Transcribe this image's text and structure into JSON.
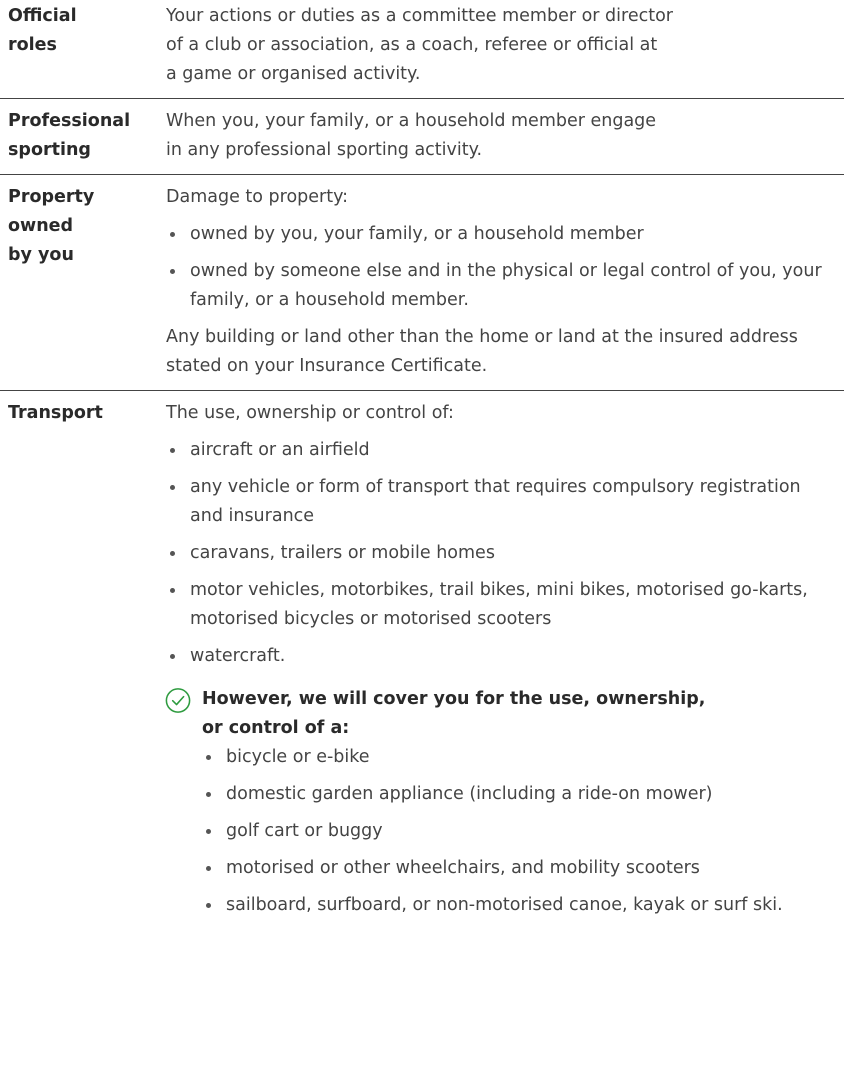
{
  "rows": [
    {
      "term": "Official roles",
      "desc": [
        "Your actions or duties as a committee member or director",
        "of a club or association, as a coach, referee or official at",
        "a game or organised activity."
      ]
    },
    {
      "term": "Professional sporting",
      "desc": [
        "When you, your family, or a household member engage",
        "in any professional sporting activity."
      ]
    },
    {
      "term": "Property owned by you",
      "intro": "Damage to property:",
      "bullets": [
        "owned by you, your family, or a household member",
        "owned by someone else and in the physical or legal control of you, your family, or a household member."
      ],
      "outro": "Any building or land other than the home or land at the insured address stated on your Insurance Certificate."
    },
    {
      "term": "Transport",
      "intro": "The use, ownership or control of:",
      "bullets": [
        "aircraft or an airfield",
        "any vehicle or form of transport that requires compulsory registration and insurance",
        "caravans, trailers or mobile homes",
        "motor vehicles, motorbikes, trail bikes, mini bikes, motorised go-karts, motorised bicycles or motorised scooters",
        "watercraft."
      ],
      "note": {
        "icon": "check-circle-icon",
        "title": "However, we will cover you for the use, ownership, or control of a:",
        "bullets": [
          "bicycle or e-bike",
          "domestic garden appliance (including a ride-on mower)",
          "golf cart or buggy",
          "motorised or other wheelchairs, and mobility scooters",
          "sailboard, surfboard, or non-motorised canoe, kayak or surf ski."
        ]
      }
    }
  ],
  "colors": {
    "text": "#444444",
    "term": "#2a2a2a",
    "rule": "#444444",
    "accent": "#2e9b3f"
  }
}
